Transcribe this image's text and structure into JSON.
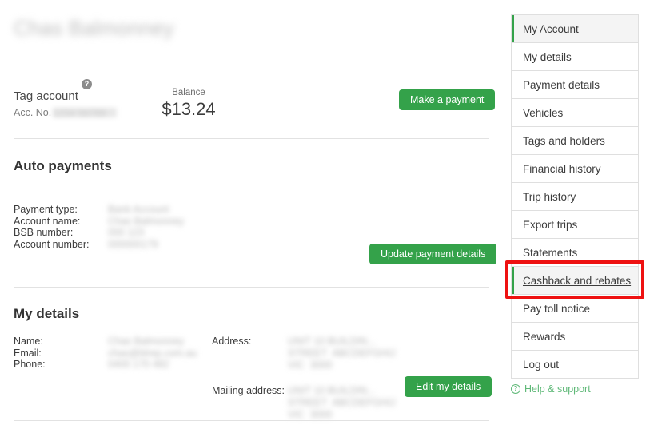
{
  "account": {
    "holder_name_redacted": "Chas Balmonney",
    "tag_account_label": "Tag account",
    "help_icon_glyph": "?",
    "acc_no_label": "Acc. No.",
    "acc_no_redacted": "1234 56789",
    "balance_label": "Balance",
    "balance_amount": "$13.24",
    "make_payment_label": "Make a payment"
  },
  "auto_payments": {
    "heading": "Auto payments",
    "update_button_label": "Update payment details",
    "fields": [
      {
        "label": "Payment type:",
        "value_redacted": "Bank Account"
      },
      {
        "label": "Account name:",
        "value_redacted": "Chas Balmonney"
      },
      {
        "label": "BSB number:",
        "value_redacted": "000 123"
      },
      {
        "label": "Account number:",
        "value_redacted": "000000179"
      }
    ]
  },
  "my_details": {
    "heading": "My details",
    "edit_button_label": "Edit my details",
    "fields": [
      {
        "label": "Name:",
        "value_redacted": "Chas Balmonney"
      },
      {
        "label": "Email:",
        "value_redacted": "chas@blrep.com.au"
      },
      {
        "label": "Phone:",
        "value_redacted": "0400 170 482"
      }
    ],
    "address": {
      "label": "Address:",
      "lines_redacted": [
        "UNIT 10 BUILDIN...",
        "STREET  ABCDEFGHIJ",
        "VIC  3000"
      ]
    },
    "mailing_address": {
      "label": "Mailing address:",
      "lines_redacted": [
        "UNIT 10 BUILDIN...",
        "STREET  ABCDEFGHIJ",
        "VIC  3000"
      ]
    }
  },
  "sidebar": {
    "items": [
      {
        "label": "My Account",
        "active": true,
        "highlighted": false
      },
      {
        "label": "My details",
        "active": false,
        "highlighted": false
      },
      {
        "label": "Payment details",
        "active": false,
        "highlighted": false
      },
      {
        "label": "Vehicles",
        "active": false,
        "highlighted": false
      },
      {
        "label": "Tags and holders",
        "active": false,
        "highlighted": false
      },
      {
        "label": "Financial history",
        "active": false,
        "highlighted": false
      },
      {
        "label": "Trip history",
        "active": false,
        "highlighted": false
      },
      {
        "label": "Export trips",
        "active": false,
        "highlighted": false
      },
      {
        "label": "Statements",
        "active": false,
        "highlighted": false
      },
      {
        "label": "Cashback and rebates",
        "active": true,
        "highlighted": true
      },
      {
        "label": "Pay toll notice",
        "active": false,
        "highlighted": false
      },
      {
        "label": "Rewards",
        "active": false,
        "highlighted": false
      },
      {
        "label": "Log out",
        "active": false,
        "highlighted": false
      }
    ],
    "help_support_label": "Help & support",
    "help_support_icon_glyph": "?"
  },
  "colors": {
    "accent_green": "#34a24a",
    "help_green": "#5fb978",
    "annotation_red": "#ee1111",
    "border_gray": "#dfdfdf",
    "active_row_bg": "#f4f4f4"
  }
}
